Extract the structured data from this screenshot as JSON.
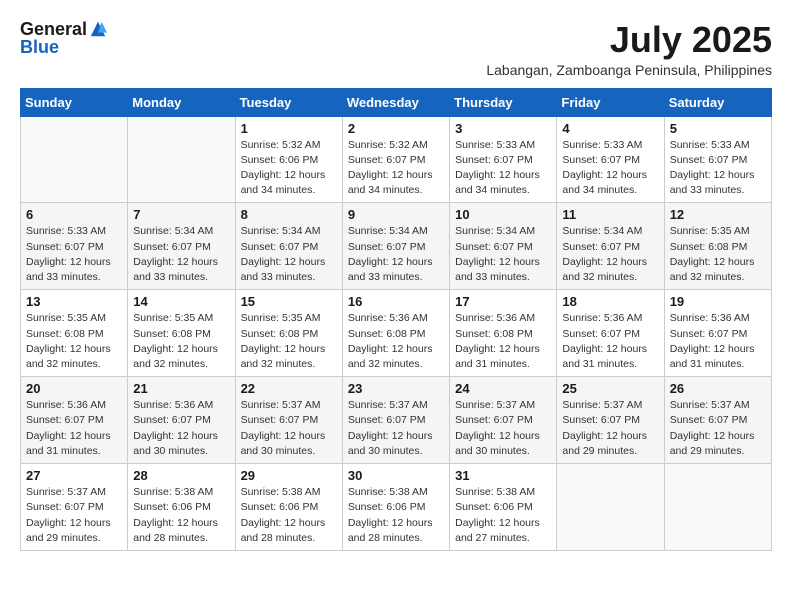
{
  "header": {
    "logo_general": "General",
    "logo_blue": "Blue",
    "month_year": "July 2025",
    "location": "Labangan, Zamboanga Peninsula, Philippines"
  },
  "weekdays": [
    "Sunday",
    "Monday",
    "Tuesday",
    "Wednesday",
    "Thursday",
    "Friday",
    "Saturday"
  ],
  "weeks": [
    [
      {
        "day": "",
        "info": ""
      },
      {
        "day": "",
        "info": ""
      },
      {
        "day": "1",
        "info": "Sunrise: 5:32 AM\nSunset: 6:06 PM\nDaylight: 12 hours\nand 34 minutes."
      },
      {
        "day": "2",
        "info": "Sunrise: 5:32 AM\nSunset: 6:07 PM\nDaylight: 12 hours\nand 34 minutes."
      },
      {
        "day": "3",
        "info": "Sunrise: 5:33 AM\nSunset: 6:07 PM\nDaylight: 12 hours\nand 34 minutes."
      },
      {
        "day": "4",
        "info": "Sunrise: 5:33 AM\nSunset: 6:07 PM\nDaylight: 12 hours\nand 34 minutes."
      },
      {
        "day": "5",
        "info": "Sunrise: 5:33 AM\nSunset: 6:07 PM\nDaylight: 12 hours\nand 33 minutes."
      }
    ],
    [
      {
        "day": "6",
        "info": "Sunrise: 5:33 AM\nSunset: 6:07 PM\nDaylight: 12 hours\nand 33 minutes."
      },
      {
        "day": "7",
        "info": "Sunrise: 5:34 AM\nSunset: 6:07 PM\nDaylight: 12 hours\nand 33 minutes."
      },
      {
        "day": "8",
        "info": "Sunrise: 5:34 AM\nSunset: 6:07 PM\nDaylight: 12 hours\nand 33 minutes."
      },
      {
        "day": "9",
        "info": "Sunrise: 5:34 AM\nSunset: 6:07 PM\nDaylight: 12 hours\nand 33 minutes."
      },
      {
        "day": "10",
        "info": "Sunrise: 5:34 AM\nSunset: 6:07 PM\nDaylight: 12 hours\nand 33 minutes."
      },
      {
        "day": "11",
        "info": "Sunrise: 5:34 AM\nSunset: 6:07 PM\nDaylight: 12 hours\nand 32 minutes."
      },
      {
        "day": "12",
        "info": "Sunrise: 5:35 AM\nSunset: 6:08 PM\nDaylight: 12 hours\nand 32 minutes."
      }
    ],
    [
      {
        "day": "13",
        "info": "Sunrise: 5:35 AM\nSunset: 6:08 PM\nDaylight: 12 hours\nand 32 minutes."
      },
      {
        "day": "14",
        "info": "Sunrise: 5:35 AM\nSunset: 6:08 PM\nDaylight: 12 hours\nand 32 minutes."
      },
      {
        "day": "15",
        "info": "Sunrise: 5:35 AM\nSunset: 6:08 PM\nDaylight: 12 hours\nand 32 minutes."
      },
      {
        "day": "16",
        "info": "Sunrise: 5:36 AM\nSunset: 6:08 PM\nDaylight: 12 hours\nand 32 minutes."
      },
      {
        "day": "17",
        "info": "Sunrise: 5:36 AM\nSunset: 6:08 PM\nDaylight: 12 hours\nand 31 minutes."
      },
      {
        "day": "18",
        "info": "Sunrise: 5:36 AM\nSunset: 6:07 PM\nDaylight: 12 hours\nand 31 minutes."
      },
      {
        "day": "19",
        "info": "Sunrise: 5:36 AM\nSunset: 6:07 PM\nDaylight: 12 hours\nand 31 minutes."
      }
    ],
    [
      {
        "day": "20",
        "info": "Sunrise: 5:36 AM\nSunset: 6:07 PM\nDaylight: 12 hours\nand 31 minutes."
      },
      {
        "day": "21",
        "info": "Sunrise: 5:36 AM\nSunset: 6:07 PM\nDaylight: 12 hours\nand 30 minutes."
      },
      {
        "day": "22",
        "info": "Sunrise: 5:37 AM\nSunset: 6:07 PM\nDaylight: 12 hours\nand 30 minutes."
      },
      {
        "day": "23",
        "info": "Sunrise: 5:37 AM\nSunset: 6:07 PM\nDaylight: 12 hours\nand 30 minutes."
      },
      {
        "day": "24",
        "info": "Sunrise: 5:37 AM\nSunset: 6:07 PM\nDaylight: 12 hours\nand 30 minutes."
      },
      {
        "day": "25",
        "info": "Sunrise: 5:37 AM\nSunset: 6:07 PM\nDaylight: 12 hours\nand 29 minutes."
      },
      {
        "day": "26",
        "info": "Sunrise: 5:37 AM\nSunset: 6:07 PM\nDaylight: 12 hours\nand 29 minutes."
      }
    ],
    [
      {
        "day": "27",
        "info": "Sunrise: 5:37 AM\nSunset: 6:07 PM\nDaylight: 12 hours\nand 29 minutes."
      },
      {
        "day": "28",
        "info": "Sunrise: 5:38 AM\nSunset: 6:06 PM\nDaylight: 12 hours\nand 28 minutes."
      },
      {
        "day": "29",
        "info": "Sunrise: 5:38 AM\nSunset: 6:06 PM\nDaylight: 12 hours\nand 28 minutes."
      },
      {
        "day": "30",
        "info": "Sunrise: 5:38 AM\nSunset: 6:06 PM\nDaylight: 12 hours\nand 28 minutes."
      },
      {
        "day": "31",
        "info": "Sunrise: 5:38 AM\nSunset: 6:06 PM\nDaylight: 12 hours\nand 27 minutes."
      },
      {
        "day": "",
        "info": ""
      },
      {
        "day": "",
        "info": ""
      }
    ]
  ]
}
